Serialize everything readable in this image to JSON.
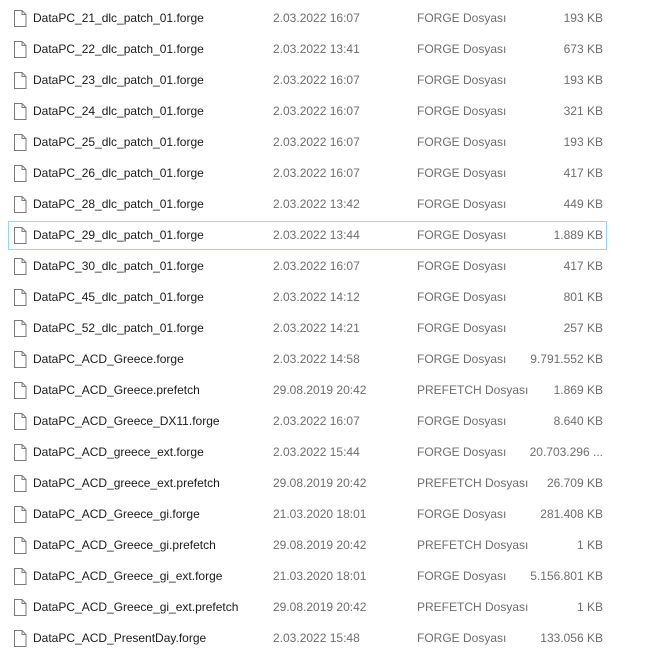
{
  "file_list": {
    "focused_index": 7,
    "rows": [
      {
        "name": "DataPC_21_dlc_patch_01.forge",
        "date": "2.03.2022 16:07",
        "type": "FORGE Dosyası",
        "size": "193 KB"
      },
      {
        "name": "DataPC_22_dlc_patch_01.forge",
        "date": "2.03.2022 13:41",
        "type": "FORGE Dosyası",
        "size": "673 KB"
      },
      {
        "name": "DataPC_23_dlc_patch_01.forge",
        "date": "2.03.2022 16:07",
        "type": "FORGE Dosyası",
        "size": "193 KB"
      },
      {
        "name": "DataPC_24_dlc_patch_01.forge",
        "date": "2.03.2022 16:07",
        "type": "FORGE Dosyası",
        "size": "321 KB"
      },
      {
        "name": "DataPC_25_dlc_patch_01.forge",
        "date": "2.03.2022 16:07",
        "type": "FORGE Dosyası",
        "size": "193 KB"
      },
      {
        "name": "DataPC_26_dlc_patch_01.forge",
        "date": "2.03.2022 16:07",
        "type": "FORGE Dosyası",
        "size": "417 KB"
      },
      {
        "name": "DataPC_28_dlc_patch_01.forge",
        "date": "2.03.2022 13:42",
        "type": "FORGE Dosyası",
        "size": "449 KB"
      },
      {
        "name": "DataPC_29_dlc_patch_01.forge",
        "date": "2.03.2022 13:44",
        "type": "FORGE Dosyası",
        "size": "1.889 KB"
      },
      {
        "name": "DataPC_30_dlc_patch_01.forge",
        "date": "2.03.2022 16:07",
        "type": "FORGE Dosyası",
        "size": "417 KB"
      },
      {
        "name": "DataPC_45_dlc_patch_01.forge",
        "date": "2.03.2022 14:12",
        "type": "FORGE Dosyası",
        "size": "801 KB"
      },
      {
        "name": "DataPC_52_dlc_patch_01.forge",
        "date": "2.03.2022 14:21",
        "type": "FORGE Dosyası",
        "size": "257 KB"
      },
      {
        "name": "DataPC_ACD_Greece.forge",
        "date": "2.03.2022 14:58",
        "type": "FORGE Dosyası",
        "size": "9.791.552 KB"
      },
      {
        "name": "DataPC_ACD_Greece.prefetch",
        "date": "29.08.2019 20:42",
        "type": "PREFETCH Dosyası",
        "size": "1.869 KB"
      },
      {
        "name": "DataPC_ACD_Greece_DX11.forge",
        "date": "2.03.2022 16:07",
        "type": "FORGE Dosyası",
        "size": "8.640 KB"
      },
      {
        "name": "DataPC_ACD_greece_ext.forge",
        "date": "2.03.2022 15:44",
        "type": "FORGE Dosyası",
        "size": "20.703.296 ..."
      },
      {
        "name": "DataPC_ACD_greece_ext.prefetch",
        "date": "29.08.2019 20:42",
        "type": "PREFETCH Dosyası",
        "size": "26.709 KB"
      },
      {
        "name": "DataPC_ACD_Greece_gi.forge",
        "date": "21.03.2020 18:01",
        "type": "FORGE Dosyası",
        "size": "281.408 KB"
      },
      {
        "name": "DataPC_ACD_Greece_gi.prefetch",
        "date": "29.08.2019 20:42",
        "type": "PREFETCH Dosyası",
        "size": "1 KB"
      },
      {
        "name": "DataPC_ACD_Greece_gi_ext.forge",
        "date": "21.03.2020 18:01",
        "type": "FORGE Dosyası",
        "size": "5.156.801 KB"
      },
      {
        "name": "DataPC_ACD_Greece_gi_ext.prefetch",
        "date": "29.08.2019 20:42",
        "type": "PREFETCH Dosyası",
        "size": "1 KB"
      },
      {
        "name": "DataPC_ACD_PresentDay.forge",
        "date": "2.03.2022 15:48",
        "type": "FORGE Dosyası",
        "size": "133.056 KB"
      }
    ]
  },
  "icons": {
    "file": "file-icon"
  },
  "colors": {
    "focus_border": "#99d1ff",
    "name_text": "#1a1a1a",
    "meta_text": "#6d6d6d"
  }
}
